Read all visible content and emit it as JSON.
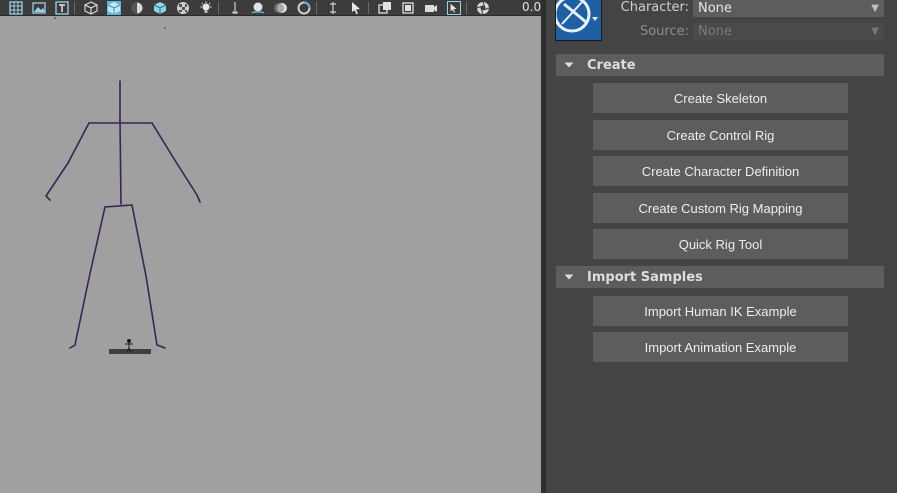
{
  "toolbar": {
    "icons": [
      "grid-icon",
      "image-plane-icon",
      "text-icon",
      "separator",
      "wireframe-cube-icon",
      "shaded-cube-icon",
      "lighting-icon",
      "textured-cube-icon",
      "checker-icon",
      "light-bulb-icon",
      "separator",
      "shadow-icon",
      "ambient-occlusion-icon",
      "motion-blur-icon",
      "antialias-icon",
      "separator",
      "xray-icon",
      "select-arrow-icon",
      "separator",
      "isolate-icon",
      "layers-icon",
      "camera-icon",
      "active-tool-icon",
      "separator",
      "aperture-icon"
    ],
    "value": "0.00"
  },
  "hik": {
    "character_label": "Character:",
    "character_value": "None",
    "source_label": "Source:",
    "source_value": "None",
    "sections": [
      {
        "title": "Create",
        "buttons": [
          "Create Skeleton",
          "Create Control Rig",
          "Create Character Definition",
          "Create Custom Rig Mapping",
          "Quick Rig Tool"
        ]
      },
      {
        "title": "Import Samples",
        "buttons": [
          "Import Human IK Example",
          "Import Animation Example"
        ]
      }
    ]
  },
  "colors": {
    "viewport_bg": "#a0a0a0",
    "panel_bg": "#444444",
    "button_bg": "#5d5d5d",
    "skeleton": "#3a2456",
    "logo_blue": "#1f5fa3"
  }
}
